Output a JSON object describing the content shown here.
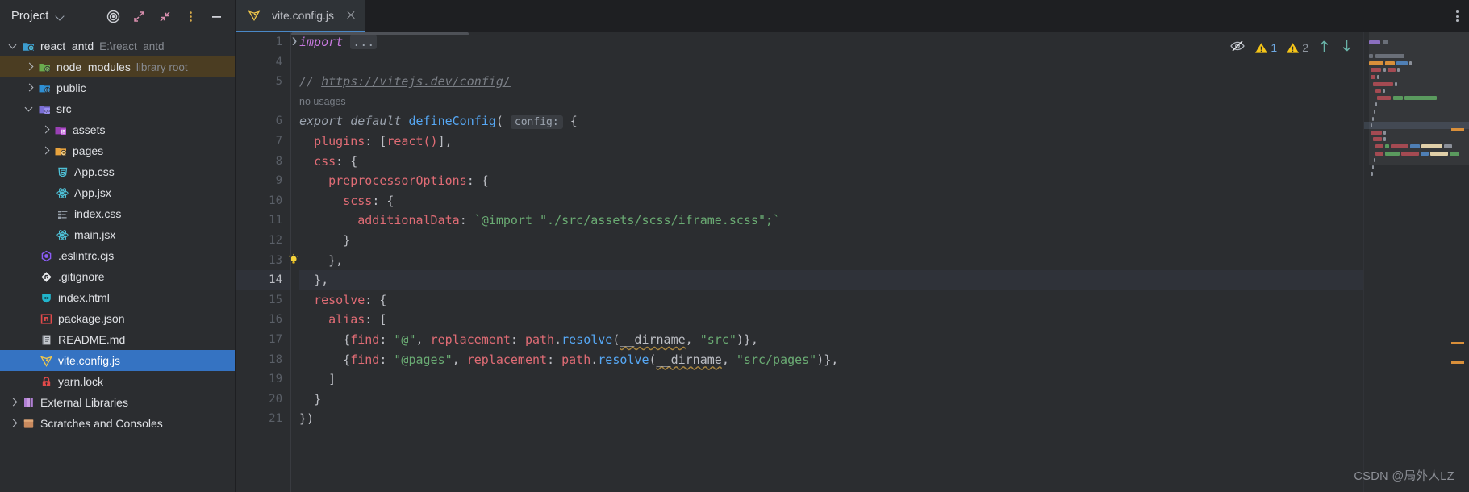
{
  "window": {
    "project_panel": {
      "title": "Project",
      "icons": [
        "target-icon",
        "expand-all-icon",
        "collapse-all-icon",
        "more-options-icon",
        "hide-panel-icon"
      ]
    }
  },
  "tree": [
    {
      "label": "react_antd",
      "sublabel": "E:\\react_antd",
      "icon": "project-root-icon",
      "indent": 0,
      "arrow": "down",
      "state": "normal"
    },
    {
      "label": "node_modules",
      "sublabel": "library root",
      "icon": "node-modules-folder-icon",
      "indent": 1,
      "arrow": "right",
      "state": "context"
    },
    {
      "label": "public",
      "sublabel": "",
      "icon": "web-folder-icon",
      "indent": 1,
      "arrow": "right",
      "state": "normal"
    },
    {
      "label": "src",
      "sublabel": "",
      "icon": "source-folder-icon",
      "indent": 1,
      "arrow": "down",
      "state": "normal"
    },
    {
      "label": "assets",
      "sublabel": "",
      "icon": "resources-folder-icon",
      "indent": 2,
      "arrow": "right",
      "state": "normal"
    },
    {
      "label": "pages",
      "sublabel": "",
      "icon": "folder-icon",
      "indent": 2,
      "arrow": "right",
      "state": "normal"
    },
    {
      "label": "App.css",
      "sublabel": "",
      "icon": "css-file-icon",
      "indent": 2,
      "arrow": "none",
      "state": "normal"
    },
    {
      "label": "App.jsx",
      "sublabel": "",
      "icon": "react-file-icon",
      "indent": 2,
      "arrow": "none",
      "state": "normal"
    },
    {
      "label": "index.css",
      "sublabel": "",
      "icon": "style-file-icon",
      "indent": 2,
      "arrow": "none",
      "state": "normal"
    },
    {
      "label": "main.jsx",
      "sublabel": "",
      "icon": "react-file-icon",
      "indent": 2,
      "arrow": "none",
      "state": "normal"
    },
    {
      "label": ".eslintrc.cjs",
      "sublabel": "",
      "icon": "eslint-file-icon",
      "indent": 1,
      "arrow": "none",
      "state": "normal"
    },
    {
      "label": ".gitignore",
      "sublabel": "",
      "icon": "git-file-icon",
      "indent": 1,
      "arrow": "none",
      "state": "normal"
    },
    {
      "label": "index.html",
      "sublabel": "",
      "icon": "html-file-icon",
      "indent": 1,
      "arrow": "none",
      "state": "normal"
    },
    {
      "label": "package.json",
      "sublabel": "",
      "icon": "npm-file-icon",
      "indent": 1,
      "arrow": "none",
      "state": "normal"
    },
    {
      "label": "README.md",
      "sublabel": "",
      "icon": "markdown-file-icon",
      "indent": 1,
      "arrow": "none",
      "state": "normal"
    },
    {
      "label": "vite.config.js",
      "sublabel": "",
      "icon": "vite-file-icon",
      "indent": 1,
      "arrow": "none",
      "state": "selected"
    },
    {
      "label": "yarn.lock",
      "sublabel": "",
      "icon": "lock-file-icon",
      "indent": 1,
      "arrow": "none",
      "state": "normal"
    },
    {
      "label": "External Libraries",
      "sublabel": "",
      "icon": "libraries-icon",
      "indent": 0,
      "arrow": "right",
      "state": "normal"
    },
    {
      "label": "Scratches and Consoles",
      "sublabel": "",
      "icon": "scratches-icon",
      "indent": 0,
      "arrow": "none",
      "state": "normal"
    }
  ],
  "editor": {
    "tab": {
      "label": "vite.config.js",
      "icon": "vite-file-icon",
      "close_icon": "close-icon"
    },
    "inspections": {
      "eye_icon": "hide-inspections-icon",
      "warning_icon": "warning-triangle-icon",
      "first_count": "1",
      "second_count": "2",
      "up_icon": "previous-problem-icon",
      "down_icon": "next-problem-icon"
    },
    "hints": {
      "no_usages": "no usages",
      "config_param": "config:"
    },
    "lines": [
      {
        "num": "1",
        "fold": true
      },
      {
        "num": "4"
      },
      {
        "num": "5"
      },
      {
        "num": "",
        "hint": "no usages"
      },
      {
        "num": "6"
      },
      {
        "num": "7"
      },
      {
        "num": "8"
      },
      {
        "num": "9"
      },
      {
        "num": "10"
      },
      {
        "num": "11"
      },
      {
        "num": "12"
      },
      {
        "num": "13",
        "bulb": true
      },
      {
        "num": "14",
        "highlight": true
      },
      {
        "num": "15"
      },
      {
        "num": "16"
      },
      {
        "num": "17"
      },
      {
        "num": "18"
      },
      {
        "num": "19"
      },
      {
        "num": "20"
      },
      {
        "num": "21"
      }
    ],
    "source_text": [
      "import ...",
      "",
      "// https://vitejs.dev/config/",
      "export default defineConfig( config: {",
      "  plugins: [react()],",
      "  css: {",
      "    preprocessorOptions: {",
      "      scss: {",
      "        additionalData: `@import \"./src/assets/scss/iframe.scss\";`",
      "      }",
      "    },",
      "  },",
      "  resolve: {",
      "    alias: [",
      "      {find: \"@\", replacement: path.resolve(__dirname, \"src\")},",
      "      {find: \"@pages\", replacement: path.resolve(__dirname, \"src/pages\")},",
      "    ]",
      "  }",
      "})"
    ],
    "tokens": {
      "import": "import",
      "ellipsis": "...",
      "comment_slashes": "// ",
      "comment_url": "https://vitejs.dev/config/",
      "export": "export",
      "default": "default",
      "defineConfig": "defineConfig",
      "paren_open": "(",
      "brace_open": "{",
      "plugins": "plugins",
      "react_call": "react()",
      "css": "css",
      "preprocessorOptions": "preprocessorOptions",
      "scss": "scss",
      "additionalData": "additionalData",
      "scss_import": "`@import \"./src/assets/scss/iframe.scss\";`",
      "resolve": "resolve",
      "alias": "alias",
      "find": "find",
      "at_alias": "\"@\"",
      "at_pages_alias": "\"@pages\"",
      "replacement": "replacement",
      "path": "path",
      "resolve_fn": "resolve",
      "dirname": "__dirname",
      "src_str": "\"src\"",
      "src_pages_str": "\"src/pages\"",
      "close_all": "})"
    }
  },
  "watermark": "CSDN @局外人LZ"
}
